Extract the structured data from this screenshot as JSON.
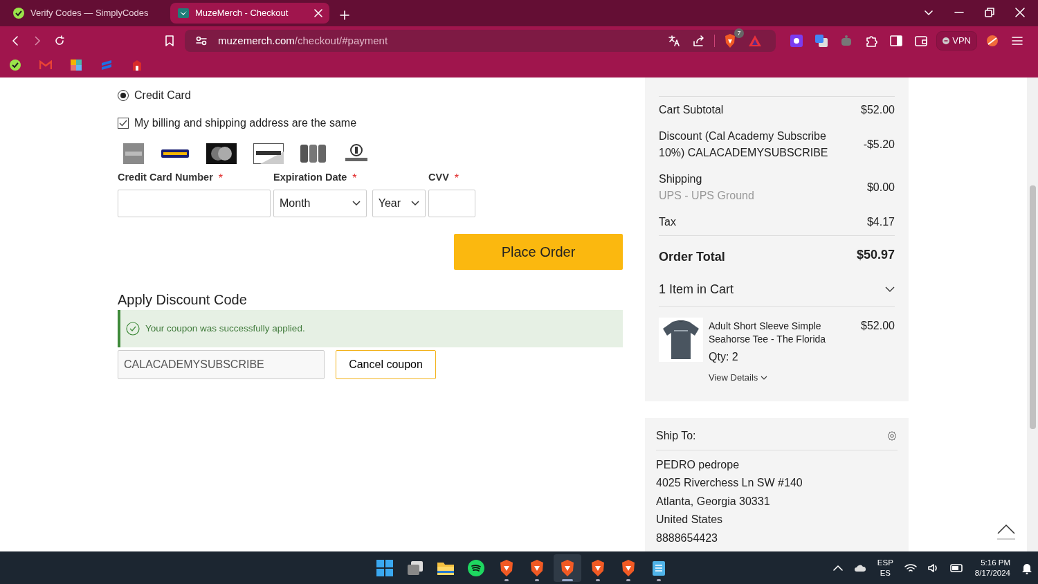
{
  "browser": {
    "tabs": [
      {
        "title": "Verify Codes — SimplyCodes",
        "selected": false
      },
      {
        "title": "MuzeMerch - Checkout",
        "selected": true
      }
    ],
    "address": {
      "domain": "muzemerch.com",
      "path": "/checkout/#payment"
    },
    "shields_count": "7",
    "vpn_label": "VPN"
  },
  "payment": {
    "method": {
      "label": "Credit Card",
      "selected": true
    },
    "same_address": {
      "label": "My billing and shipping address are the same",
      "checked": true
    },
    "card_number": {
      "label": "Credit Card Number",
      "required_mark": "*"
    },
    "expiration": {
      "label": "Expiration Date",
      "required_mark": "*",
      "month": "Month",
      "year": "Year"
    },
    "cvv": {
      "label": "CVV",
      "required_mark": "*"
    },
    "place_order": "Place Order"
  },
  "discount": {
    "heading": "Apply Discount Code",
    "alert": "Your coupon was successfully applied.",
    "code": "CALACADEMYSUBSCRIBE",
    "cancel": "Cancel coupon"
  },
  "summary": {
    "rows": [
      {
        "label": "Cart Subtotal",
        "amount": "$52.00"
      },
      {
        "label": "Discount (Cal Academy Subscribe 10%) CALACADEMYSUBSCRIBE",
        "amount": "-$5.20"
      },
      {
        "label": "Shipping",
        "sublabel": "UPS - UPS Ground",
        "amount": "$0.00"
      },
      {
        "label": "Tax",
        "amount": "$4.17"
      }
    ],
    "total": {
      "label": "Order Total",
      "amount": "$50.97"
    },
    "cart": {
      "label": "1 Item in Cart",
      "expanded": false
    },
    "items": [
      {
        "name": "Adult Short Sleeve Simple Seahorse Tee - The Florida",
        "qty": "Qty: 2",
        "price": "$52.00",
        "details": "View Details"
      }
    ]
  },
  "ship_to": {
    "title": "Ship To:",
    "lines": [
      "PEDRO pedrope",
      "4025 Riverchess Ln SW #140",
      "Atlanta, Georgia 30331",
      "United States",
      "8888654423"
    ]
  },
  "taskbar": {
    "apps": [
      {
        "kind": "start",
        "selected": false,
        "running": false
      },
      {
        "kind": "taskview",
        "selected": false,
        "running": false
      },
      {
        "kind": "folder",
        "selected": false,
        "running": false
      },
      {
        "kind": "music",
        "selected": false,
        "running": false
      },
      {
        "kind": "browser",
        "selected": false,
        "running": true
      },
      {
        "kind": "browser",
        "selected": false,
        "running": true
      },
      {
        "kind": "browser",
        "selected": true,
        "running": true
      },
      {
        "kind": "browser",
        "selected": false,
        "running": true
      },
      {
        "kind": "browser",
        "selected": false,
        "running": true
      },
      {
        "kind": "notepad",
        "selected": false,
        "running": true
      }
    ],
    "language": "ESP",
    "layout": "ES",
    "time": "5:16 PM",
    "date": "8/17/2024"
  }
}
